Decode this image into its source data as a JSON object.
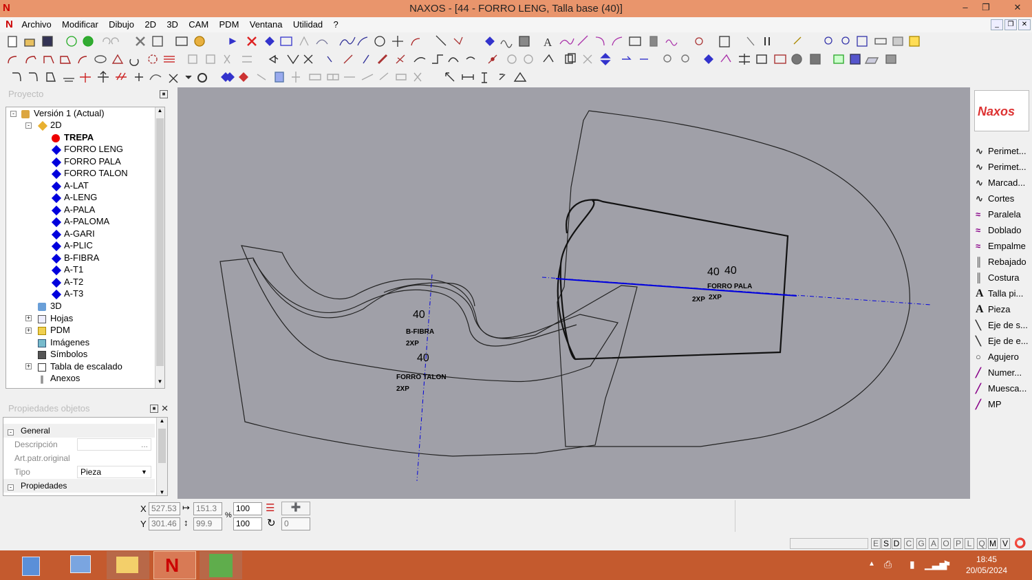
{
  "window": {
    "title": "NAXOS - [44 - FORRO LENG, Talla base (40)]"
  },
  "menu": [
    "Archivo",
    "Modificar",
    "Dibujo",
    "2D",
    "3D",
    "CAM",
    "PDM",
    "Ventana",
    "Utilidad",
    "?"
  ],
  "project_panel": {
    "title": "Proyecto",
    "tree": [
      {
        "label": "Versión 1 (Actual)"
      },
      {
        "label": "2D"
      },
      {
        "label": "TREPA"
      },
      {
        "label": "FORRO LENG"
      },
      {
        "label": "FORRO PALA"
      },
      {
        "label": "FORRO TALON"
      },
      {
        "label": "A-LAT"
      },
      {
        "label": "A-LENG"
      },
      {
        "label": "A-PALA"
      },
      {
        "label": "A-PALOMA"
      },
      {
        "label": "A-GARI"
      },
      {
        "label": "A-PLIC"
      },
      {
        "label": "B-FIBRA"
      },
      {
        "label": "A-T1"
      },
      {
        "label": "A-T2"
      },
      {
        "label": "A-T3"
      },
      {
        "label": "3D"
      },
      {
        "label": "Hojas"
      },
      {
        "label": "PDM"
      },
      {
        "label": "Imágenes"
      },
      {
        "label": "Símbolos"
      },
      {
        "label": "Tabla de escalado"
      },
      {
        "label": "Anexos"
      }
    ]
  },
  "props_panel": {
    "title": "Propiedades objetos",
    "general": "General",
    "descripcion": "Descripción",
    "art_patr": "Art.patr.original",
    "tipo_label": "Tipo",
    "tipo_value": "Pieza",
    "propiedades": "Propiedades"
  },
  "canvas": {
    "labels": {
      "size_a": "40",
      "name_a": "B-FIBRA",
      "qty_a": "2XP",
      "size_b": "40",
      "name_b": "FORRO TALON",
      "qty_b": "2XP",
      "size_c1": "40",
      "size_c2": "40",
      "name_c": "FORRO PALA",
      "qty_c1": "2XP",
      "qty_c2": "2XP"
    }
  },
  "right_panel": {
    "logo": "Naxos",
    "items": [
      "Perimet...",
      "Perimet...",
      "Marcad...",
      "Cortes",
      "Paralela",
      "Doblado",
      "Empalme",
      "Rebajado",
      "Costura",
      "Talla pi...",
      "Pieza",
      "Eje de s...",
      "Eje de e...",
      "Agujero",
      "Numer...",
      "Muesca...",
      "MP"
    ]
  },
  "coords": {
    "x_label": "X",
    "y_label": "Y",
    "x": "527.53",
    "y": "301.46",
    "w": "151.3",
    "h": "99.9",
    "pct_label": "%",
    "sx": "100",
    "sy": "100",
    "rot": "0"
  },
  "status": {
    "letters": [
      "E",
      "S",
      "D",
      "C",
      "G",
      "A",
      "O",
      "P",
      "L",
      "Q",
      "M",
      "V"
    ]
  },
  "taskbar": {
    "time": "18:45",
    "date": "20/05/2024"
  },
  "colors": {
    "accent": "#e9956c",
    "taskbar": "#c45a2e",
    "canvas": "#a0a0a8",
    "axis_blue": "#0000dd"
  }
}
